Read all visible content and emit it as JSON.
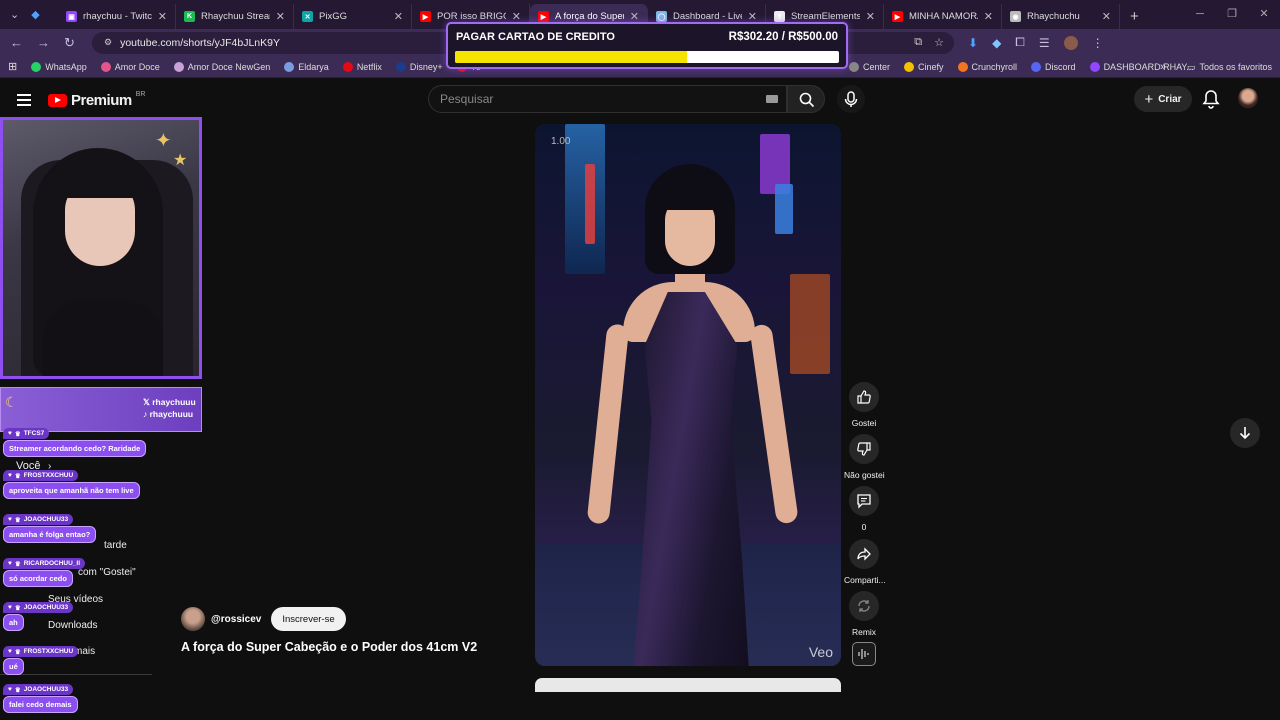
{
  "browser": {
    "tabs": [
      {
        "title": "rhaychuu - Twitch",
        "fav_color": "#9146ff",
        "fav_text": "▣"
      },
      {
        "title": "Rhaychuu Stream - V",
        "fav_color": "#1db954",
        "fav_text": "K"
      },
      {
        "title": "PixGG",
        "fav_color": "#12a4a4",
        "fav_text": "✕"
      },
      {
        "title": "POR isso BRIGGS ter",
        "fav_color": "#ff0000",
        "fav_text": "▶"
      },
      {
        "title": "A força do Super Ca",
        "fav_color": "#ff0000",
        "fav_text": "▶",
        "active": true
      },
      {
        "title": "Dashboard - LivePix",
        "fav_color": "#7fb6e6",
        "fav_text": "◯"
      },
      {
        "title": "StreamElements - A",
        "fav_color": "#eeeeee",
        "fav_text": "⬆"
      },
      {
        "title": "MINHA NAMORADA",
        "fav_color": "#ff0000",
        "fav_text": "▶"
      },
      {
        "title": "Rhaychuchu",
        "fav_color": "#bbbbbb",
        "fav_text": "◉"
      }
    ],
    "url": "youtube.com/shorts/yJF4bJLnK9Y",
    "bookmarks": [
      {
        "label": "WhatsApp",
        "color": "#25d366"
      },
      {
        "label": "Amor Doce",
        "color": "#e6548c"
      },
      {
        "label": "Amor Doce NewGen",
        "color": "#c9a0d8"
      },
      {
        "label": "Eldarya",
        "color": "#7c9be0"
      },
      {
        "label": "Netflix",
        "color": "#e50914"
      },
      {
        "label": "Disney+",
        "color": "#1e3a8a"
      },
      {
        "label": "Yo",
        "color": "#ff0000"
      }
    ],
    "bookmarks_right": [
      {
        "label": "Center",
        "color": "#888888"
      },
      {
        "label": "Cinefy",
        "color": "#f2c200"
      },
      {
        "label": "Crunchyroll",
        "color": "#f47521"
      },
      {
        "label": "Discord",
        "color": "#5865f2"
      },
      {
        "label": "DASHBOARD RHAY...",
        "color": "#9146ff"
      }
    ],
    "all_favorites": "Todos os favoritos",
    "more": "»"
  },
  "youtube": {
    "brand": "Premium",
    "region": "BR",
    "search_placeholder": "Pesquisar",
    "create_label": "Criar"
  },
  "goal": {
    "title": "PAGAR CARTAO DE CREDITO",
    "amount": "R$302.20 / R$500.00",
    "progress": 0.6044,
    "fill_color": "#f5e400"
  },
  "sidebar_remnants": {
    "voce": "Você",
    "tarde": "tarde",
    "gostei": "com \"Gostei\"",
    "seus_videos": "Seus vídeos",
    "downloads": "Downloads",
    "mais": "mais"
  },
  "overlay": {
    "handle_x": "rhaychuuu",
    "handle_tiktok": "rhaychuuu"
  },
  "chat": [
    {
      "user": "TFCS7",
      "text": "Streamer acordando cedo? Raridade"
    },
    {
      "user": "FROSTXXCHUU",
      "text": "aproveita que amanhã não tem live"
    },
    {
      "user": "JOAOCHUU33",
      "text": "amanha é folga entao?"
    },
    {
      "user": "RICARDOCHUU_II",
      "text": "só acordar cedo"
    },
    {
      "user": "JOAOCHUU33",
      "text": "ah"
    },
    {
      "user": "FROSTXXCHUU",
      "text": "ué"
    },
    {
      "user": "JOAOCHUU33",
      "text": "falei cedo demais"
    }
  ],
  "short": {
    "speed": "1.00",
    "watermark": "Veo",
    "channel": "@rossicev",
    "subscribe": "Inscrever-se",
    "title": "A força do Super Cabeção e o Poder dos 41cm V2"
  },
  "actions": {
    "like": "Gostei",
    "dislike": "Não gostei",
    "comments": "0",
    "share": "Comparti...",
    "remix": "Remix"
  }
}
